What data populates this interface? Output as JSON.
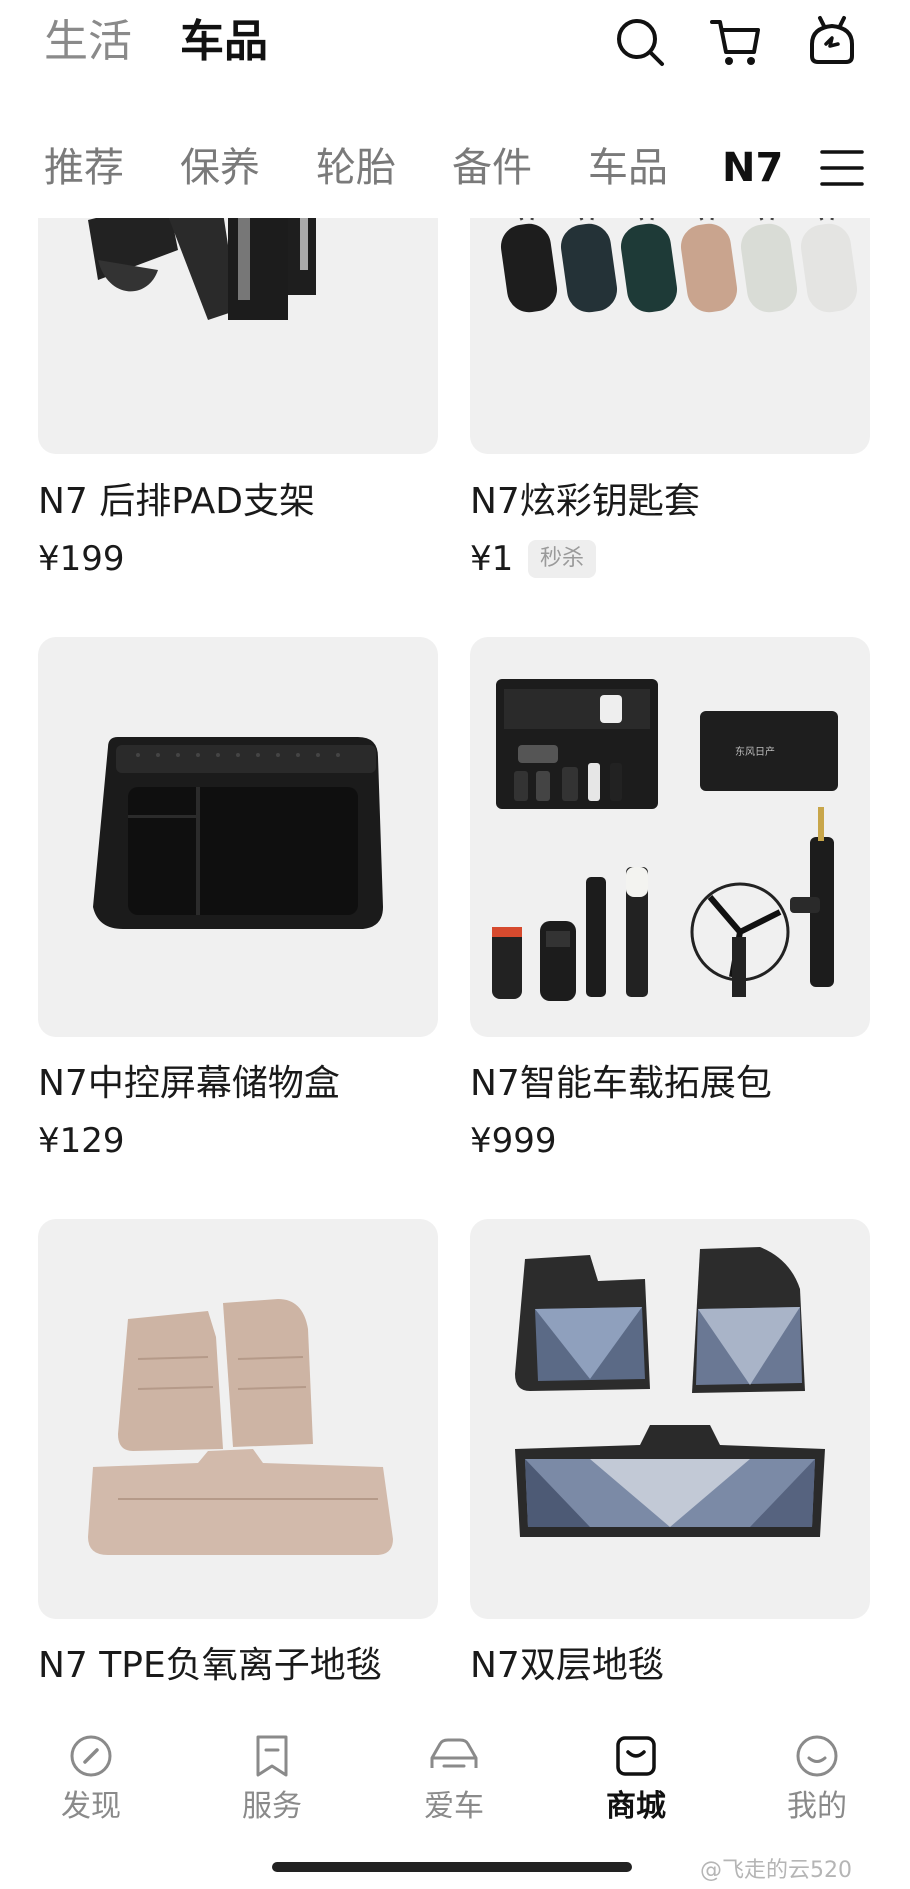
{
  "header": {
    "tabs": [
      {
        "label": "生活",
        "active": false
      },
      {
        "label": "车品",
        "active": true
      }
    ],
    "icons": [
      "search-icon",
      "cart-icon",
      "service-icon"
    ]
  },
  "categories": [
    {
      "label": "推荐",
      "active": false
    },
    {
      "label": "保养",
      "active": false
    },
    {
      "label": "轮胎",
      "active": false
    },
    {
      "label": "备件",
      "active": false
    },
    {
      "label": "车品",
      "active": false
    },
    {
      "label": "N7",
      "active": true
    }
  ],
  "products": [
    {
      "name": "N7 后排PAD支架",
      "price": "¥199"
    },
    {
      "name": "N7炫彩钥匙套",
      "price": "¥1",
      "badge": "秒杀"
    },
    {
      "name": "N7中控屏幕储物盒",
      "price": "¥129"
    },
    {
      "name": "N7智能车载拓展包",
      "price": "¥999"
    },
    {
      "name": "N7 TPE负氧离子地毯",
      "price": ""
    },
    {
      "name": "N7双层地毯",
      "price": ""
    }
  ],
  "kit_case_text": "东风日产",
  "bottom_nav": [
    {
      "label": "发现",
      "icon": "compass-icon",
      "active": false
    },
    {
      "label": "服务",
      "icon": "bookmark-icon",
      "active": false
    },
    {
      "label": "爱车",
      "icon": "car-icon",
      "active": false
    },
    {
      "label": "商城",
      "icon": "shop-bag-icon",
      "active": true
    },
    {
      "label": "我的",
      "icon": "smile-icon",
      "active": false
    }
  ],
  "watermark": "@飞走的云520",
  "colors": {
    "card_bg": "#f0f0f0",
    "inactive_text": "#8a8a8a",
    "active_text": "#111111"
  }
}
